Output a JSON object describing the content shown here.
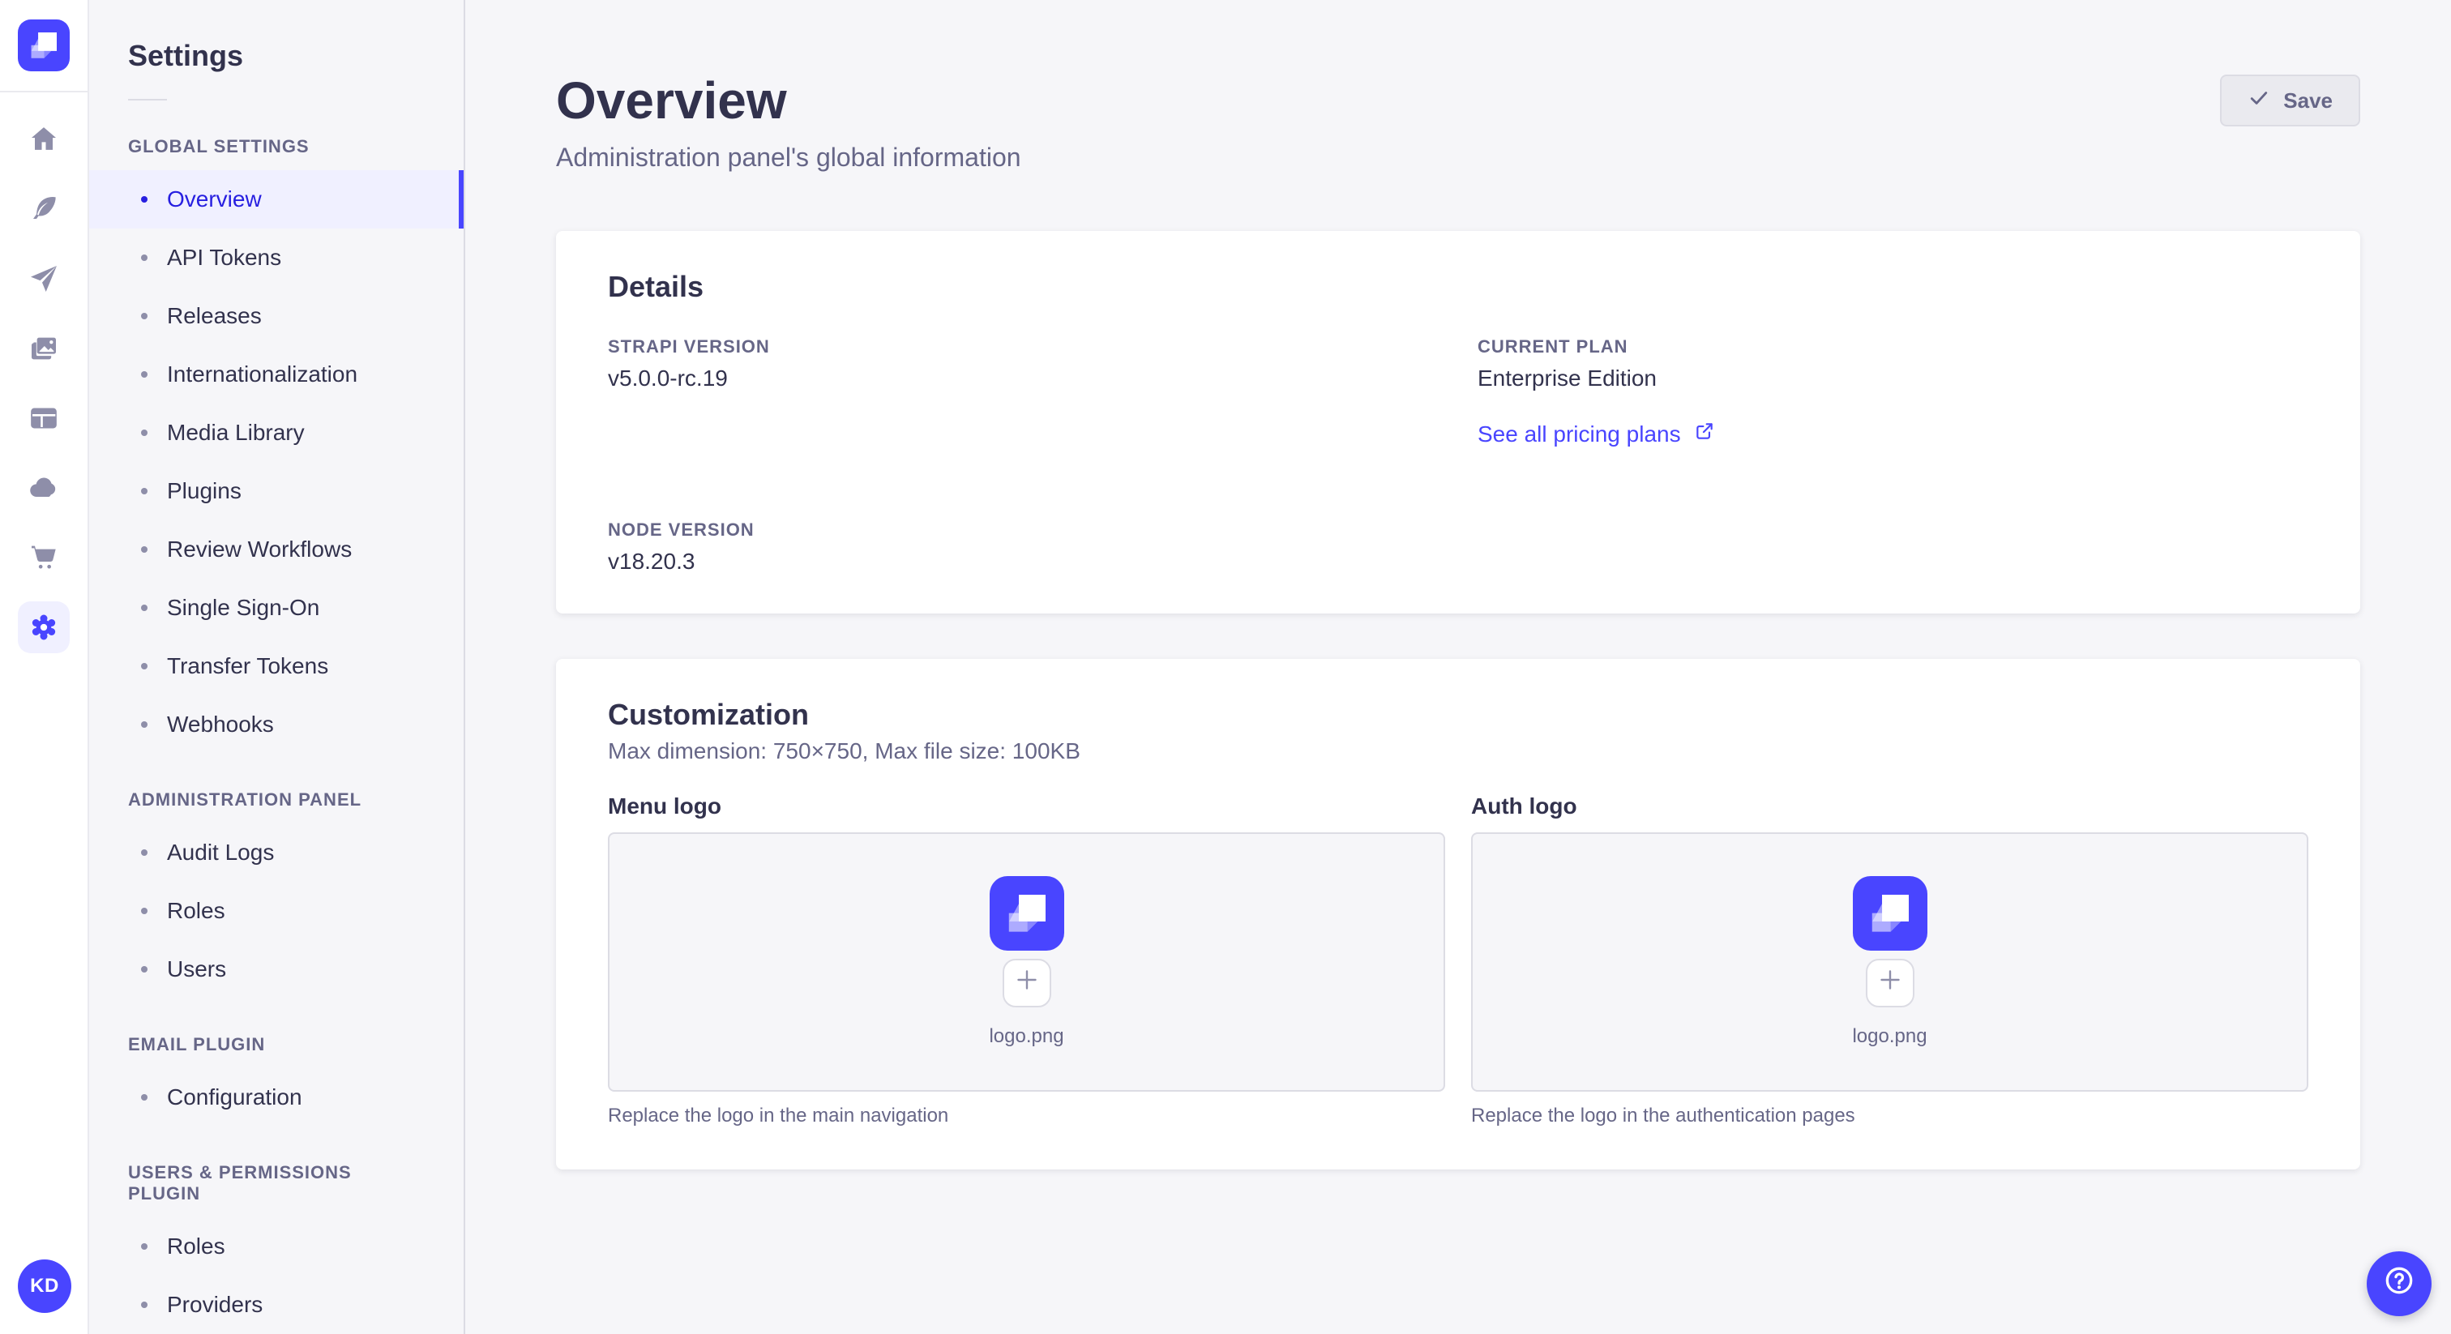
{
  "rail": {
    "logo_name": "strapi-logo",
    "items": [
      {
        "name": "home",
        "active": false
      },
      {
        "name": "content-type-builder",
        "active": false
      },
      {
        "name": "deploy",
        "active": false
      },
      {
        "name": "media-library",
        "active": false
      },
      {
        "name": "content-manager",
        "active": false
      },
      {
        "name": "cloud",
        "active": false
      },
      {
        "name": "marketplace",
        "active": false
      },
      {
        "name": "settings",
        "active": true
      }
    ],
    "avatar_initials": "KD"
  },
  "settings_nav": {
    "title": "Settings",
    "sections": [
      {
        "label": "GLOBAL SETTINGS",
        "items": [
          {
            "label": "Overview",
            "active": true
          },
          {
            "label": "API Tokens",
            "active": false
          },
          {
            "label": "Releases",
            "active": false
          },
          {
            "label": "Internationalization",
            "active": false
          },
          {
            "label": "Media Library",
            "active": false
          },
          {
            "label": "Plugins",
            "active": false
          },
          {
            "label": "Review Workflows",
            "active": false
          },
          {
            "label": "Single Sign-On",
            "active": false
          },
          {
            "label": "Transfer Tokens",
            "active": false
          },
          {
            "label": "Webhooks",
            "active": false
          }
        ]
      },
      {
        "label": "ADMINISTRATION PANEL",
        "items": [
          {
            "label": "Audit Logs",
            "active": false
          },
          {
            "label": "Roles",
            "active": false
          },
          {
            "label": "Users",
            "active": false
          }
        ]
      },
      {
        "label": "EMAIL PLUGIN",
        "items": [
          {
            "label": "Configuration",
            "active": false
          }
        ]
      },
      {
        "label": "USERS & PERMISSIONS PLUGIN",
        "items": [
          {
            "label": "Roles",
            "active": false
          },
          {
            "label": "Providers",
            "active": false
          }
        ]
      }
    ]
  },
  "header": {
    "title": "Overview",
    "subtitle": "Administration panel's global information",
    "save_label": "Save"
  },
  "details": {
    "title": "Details",
    "strapi_version": {
      "label": "STRAPI VERSION",
      "value": "v5.0.0-rc.19"
    },
    "current_plan": {
      "label": "CURRENT PLAN",
      "value": "Enterprise Edition"
    },
    "node_version": {
      "label": "NODE VERSION",
      "value": "v18.20.3"
    },
    "pricing_link_label": "See all pricing plans"
  },
  "customization": {
    "title": "Customization",
    "subtitle": "Max dimension: 750×750, Max file size: 100KB",
    "menu_logo": {
      "label": "Menu logo",
      "filename": "logo.png",
      "hint": "Replace the logo in the main navigation"
    },
    "auth_logo": {
      "label": "Auth logo",
      "filename": "logo.png",
      "hint": "Replace the logo in the authentication pages"
    }
  },
  "colors": {
    "brand": "#4945FF",
    "active_text": "#271FE0",
    "active_bg": "#F0F0FF",
    "text": "#32324D",
    "text_secondary": "#666687",
    "icon_gray": "#8E8EA9",
    "border": "#DCDCE4",
    "page_bg": "#F6F6F9",
    "card_bg": "#FFFFFF"
  }
}
